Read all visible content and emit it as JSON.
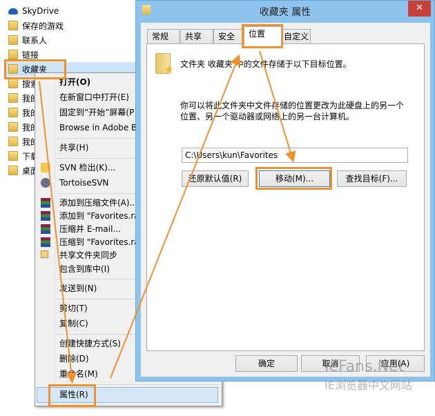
{
  "tree": {
    "items": [
      {
        "label": "SkyDrive",
        "icon": "cloud-icon"
      },
      {
        "label": "保存的游戏",
        "icon": "folder-games-icon"
      },
      {
        "label": "联系人",
        "icon": "folder-contacts-icon"
      },
      {
        "label": "链接",
        "icon": "folder-links-icon"
      },
      {
        "label": "收藏夹",
        "icon": "folder-favorites-icon"
      },
      {
        "label": "搜索",
        "icon": "folder-search-icon"
      },
      {
        "label": "我的",
        "icon": "folder-videos-icon"
      },
      {
        "label": "我的",
        "icon": "folder-pictures-icon"
      },
      {
        "label": "我的",
        "icon": "folder-documents-icon"
      },
      {
        "label": "我的",
        "icon": "folder-music-icon"
      },
      {
        "label": "下载",
        "icon": "folder-downloads-icon"
      },
      {
        "label": "桌面",
        "icon": "folder-desktop-icon"
      }
    ]
  },
  "menu": {
    "items": [
      {
        "label": "打开(O)"
      },
      {
        "label": "在新窗口中打开(E)"
      },
      {
        "label": "固定到“开始”屏幕(P)"
      },
      {
        "label": "Browse in Adobe Bridge"
      },
      {
        "label": "共享(H)"
      },
      {
        "label": "SVN 检出(K)..."
      },
      {
        "label": "TortoiseSVN"
      },
      {
        "label": "添加到压缩文件(A)..."
      },
      {
        "label": "添加到 \"Favorites.rar\""
      },
      {
        "label": "压缩并 E-mail..."
      },
      {
        "label": "压缩到 \"Favorites.rar\" 并 E-mail"
      },
      {
        "label": "共享文件夹同步"
      },
      {
        "label": "包含到库中(I)"
      },
      {
        "label": "发送到(N)"
      },
      {
        "label": "剪切(T)"
      },
      {
        "label": "复制(C)"
      },
      {
        "label": "创建快捷方式(S)"
      },
      {
        "label": "删除(D)"
      },
      {
        "label": "重命名(M)"
      },
      {
        "label": "属性(R)"
      }
    ]
  },
  "dialog": {
    "title": "收藏夹 属性",
    "close": "✕",
    "tabs": [
      "常规",
      "共享",
      "安全",
      "位置",
      "自定义"
    ],
    "info": "文件夹 收藏夹 中的文件存储于以下目标位置。",
    "desc1": "你可以将此文件夹中文件存储的位置更改为此硬盘上的另一个",
    "desc2": "位置、另一个驱动器或网络上的另一台计算机。",
    "path": "C:\\Users\\kun\\Favorites",
    "restore": "还原默认值(R)",
    "move": "移动(M)...",
    "find": "查找目标(F)...",
    "ok": "确定",
    "cancel": "取消",
    "apply": "应用(A)"
  },
  "watermark": {
    "line1": "IeFans.Net",
    "line2": "IE浏览器中文网站"
  },
  "colors": {
    "accent": "#f0912c",
    "title_bar": "#8ec3ee",
    "close": "#c7403a",
    "highlight": "#cce4f7"
  }
}
